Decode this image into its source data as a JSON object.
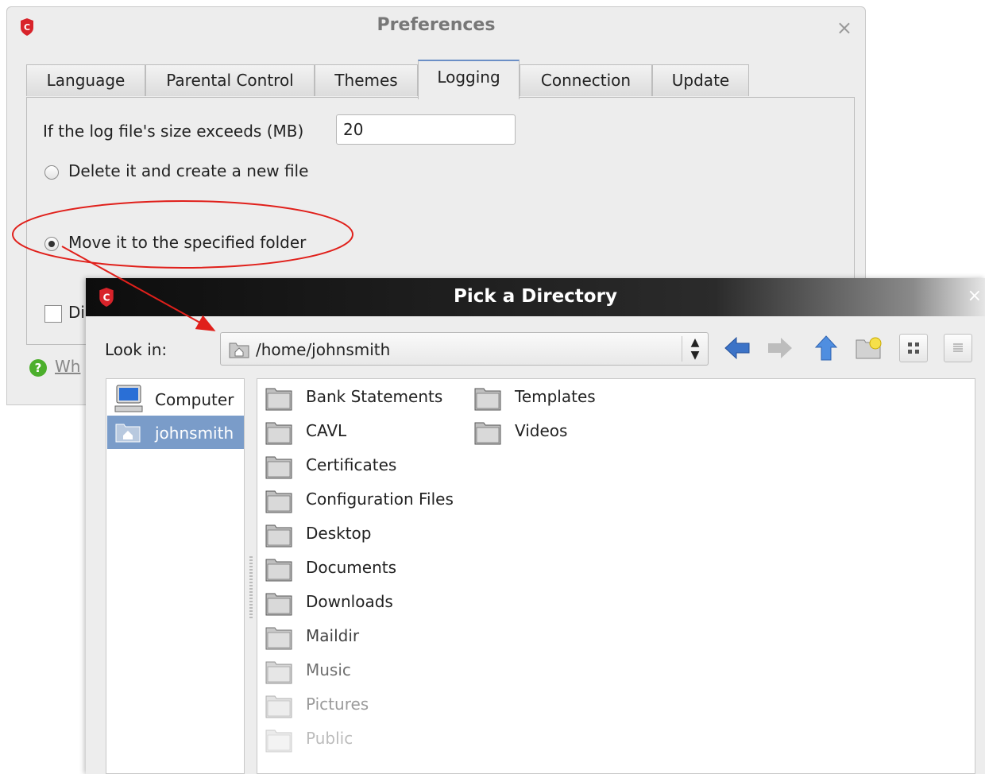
{
  "prefs": {
    "title": "Preferences",
    "close_glyph": "×",
    "app_logo_letter": "C",
    "tabs": [
      {
        "label": "Language"
      },
      {
        "label": "Parental Control"
      },
      {
        "label": "Themes"
      },
      {
        "label": "Logging",
        "active": true
      },
      {
        "label": "Connection"
      },
      {
        "label": "Update"
      }
    ],
    "logging": {
      "size_label": "If the log file's size exceeds (MB)",
      "size_value": "20",
      "option_delete": "Delete it and create a new file",
      "option_move": "Move it to  the specified folder",
      "selected_option": "move",
      "checkbox_label_partial": "Di",
      "checkbox_checked": false
    },
    "help_link_partial": "Wh",
    "help_icon_glyph": "?"
  },
  "annotation": {
    "color": "#e0201b",
    "shape": "ellipse-with-arrow"
  },
  "picker": {
    "title": "Pick a Directory",
    "close_glyph": "×",
    "app_logo_letter": "C",
    "look_in_label": "Look in:",
    "current_path": "/home/johnsmith",
    "toolbar_icons": [
      "back-arrow-icon",
      "forward-arrow-icon",
      "up-arrow-icon",
      "new-folder-icon",
      "icon-view-icon",
      "list-view-icon"
    ],
    "places": [
      {
        "label": "Computer",
        "icon": "computer-icon",
        "selected": false
      },
      {
        "label": "johnsmith",
        "icon": "home-folder-icon",
        "selected": true
      }
    ],
    "folders": [
      {
        "label": "Bank Statements",
        "faded": 0
      },
      {
        "label": "CAVL",
        "faded": 0
      },
      {
        "label": "Certificates",
        "faded": 0
      },
      {
        "label": "Configuration Files",
        "faded": 0
      },
      {
        "label": "Desktop",
        "faded": 0
      },
      {
        "label": "Documents",
        "faded": 0
      },
      {
        "label": "Downloads",
        "faded": 0
      },
      {
        "label": "Maildir",
        "faded": 0.15
      },
      {
        "label": "Music",
        "faded": 0.35
      },
      {
        "label": "Pictures",
        "faded": 0.55
      },
      {
        "label": "Public",
        "faded": 0.7
      },
      {
        "label": "Templates",
        "faded": 0
      },
      {
        "label": "Videos",
        "faded": 0
      }
    ]
  },
  "colors": {
    "accent_selection": "#7a9cc9",
    "active_tab_border": "#6b8fc6",
    "app_logo": "#d8232a",
    "toolbar_arrow_active": "#3c73c7"
  }
}
